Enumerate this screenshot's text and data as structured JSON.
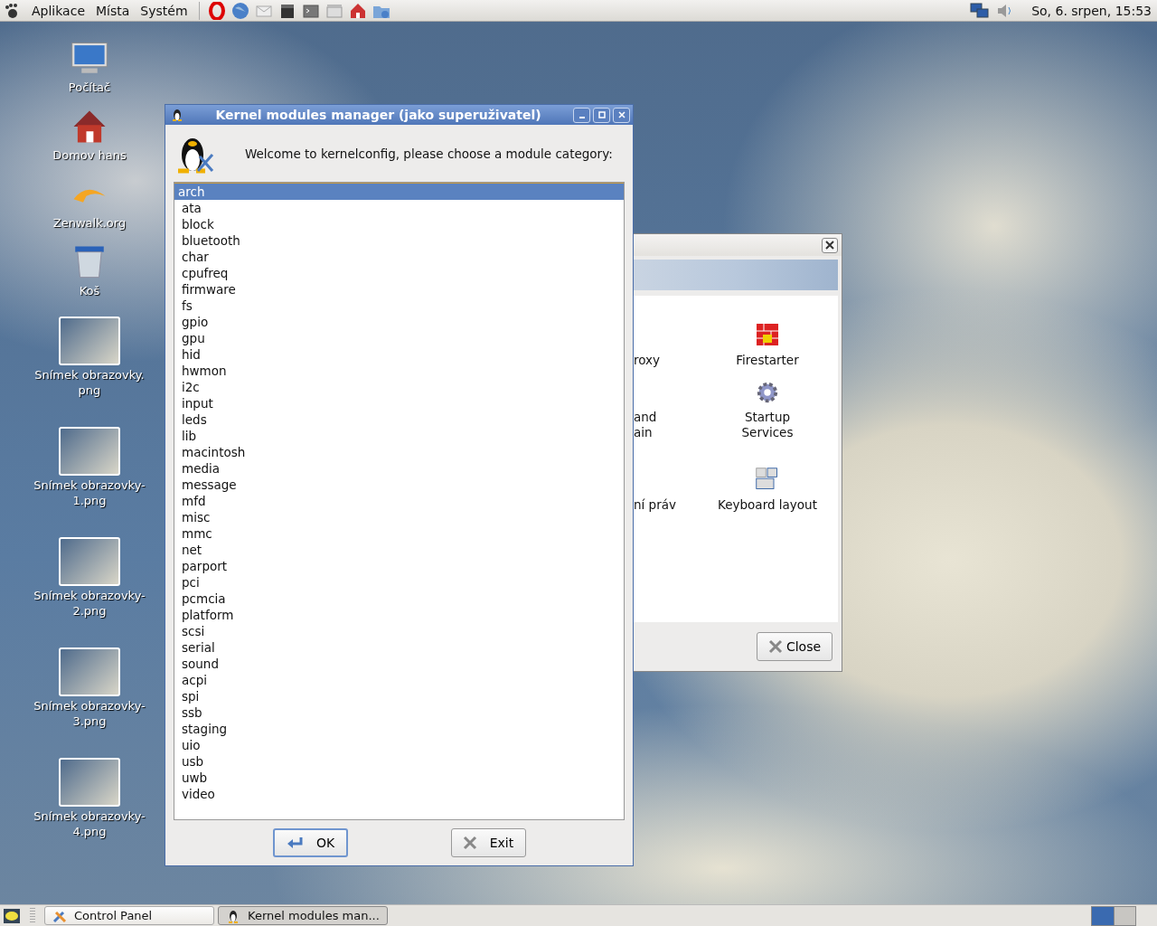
{
  "top_panel": {
    "menus": [
      "Aplikace",
      "Místa",
      "Systém"
    ],
    "clock": "So,  6. srpen, 15:53"
  },
  "desktop_icons": [
    {
      "label": "Počítač",
      "kind": "computer"
    },
    {
      "label": "Domov hans",
      "kind": "home"
    },
    {
      "label": "Zenwalk.org",
      "kind": "web"
    },
    {
      "label": "Koš",
      "kind": "trash"
    },
    {
      "label": "Snímek obrazovky.\npng",
      "kind": "screenshot"
    },
    {
      "label": "Snímek obrazovky-\n1.png",
      "kind": "screenshot"
    },
    {
      "label": "Snímek obrazovky-\n2.png",
      "kind": "screenshot"
    },
    {
      "label": "Snímek obrazovky-\n3.png",
      "kind": "screenshot"
    },
    {
      "label": "Snímek obrazovky-\n4.png",
      "kind": "screenshot"
    }
  ],
  "control_panel": {
    "items": [
      {
        "label": "roxy",
        "kind": "cut"
      },
      {
        "label": "Firestarter",
        "kind": "firewall"
      },
      {
        "label": "and\nain",
        "kind": "cut"
      },
      {
        "label": "Startup\nServices",
        "kind": "gear"
      },
      {
        "label": "ní práv",
        "kind": "cut"
      },
      {
        "label": "Keyboard layout",
        "kind": "keyboard"
      }
    ],
    "close_button": "Close"
  },
  "kernel_window": {
    "title": "Kernel modules manager (jako superuživatel)",
    "welcome": "Welcome to kernelconfig, please choose a module category:",
    "modules": [
      {
        "name": "arch",
        "selected": true
      },
      {
        "name": "ata",
        "selected": false
      },
      {
        "name": "block",
        "selected": false
      },
      {
        "name": "bluetooth",
        "selected": false
      },
      {
        "name": "char",
        "selected": false
      },
      {
        "name": "cpufreq",
        "selected": false
      },
      {
        "name": "firmware",
        "selected": false
      },
      {
        "name": "fs",
        "selected": false
      },
      {
        "name": "gpio",
        "selected": false
      },
      {
        "name": "gpu",
        "selected": false
      },
      {
        "name": "hid",
        "selected": false
      },
      {
        "name": "hwmon",
        "selected": false
      },
      {
        "name": "i2c",
        "selected": false
      },
      {
        "name": "input",
        "selected": false
      },
      {
        "name": "leds",
        "selected": false
      },
      {
        "name": "lib",
        "selected": false
      },
      {
        "name": "macintosh",
        "selected": false
      },
      {
        "name": "media",
        "selected": false
      },
      {
        "name": "message",
        "selected": false
      },
      {
        "name": "mfd",
        "selected": false
      },
      {
        "name": "misc",
        "selected": false
      },
      {
        "name": "mmc",
        "selected": false
      },
      {
        "name": "net",
        "selected": false
      },
      {
        "name": "parport",
        "selected": false
      },
      {
        "name": "pci",
        "selected": false
      },
      {
        "name": "pcmcia",
        "selected": false
      },
      {
        "name": "platform",
        "selected": false
      },
      {
        "name": "scsi",
        "selected": false
      },
      {
        "name": "serial",
        "selected": false
      },
      {
        "name": "sound",
        "selected": false
      },
      {
        "name": "acpi",
        "selected": false
      },
      {
        "name": "spi",
        "selected": false
      },
      {
        "name": "ssb",
        "selected": false
      },
      {
        "name": "staging",
        "selected": false
      },
      {
        "name": "uio",
        "selected": false
      },
      {
        "name": "usb",
        "selected": false
      },
      {
        "name": "uwb",
        "selected": false
      },
      {
        "name": "video",
        "selected": false
      }
    ],
    "buttons": [
      {
        "label": "OK",
        "kind": "ok"
      },
      {
        "label": "Exit",
        "kind": "exit"
      }
    ]
  },
  "taskbar": {
    "items": [
      {
        "label": "Control Panel",
        "kind": "tools",
        "selected": false
      },
      {
        "label": "Kernel modules man...",
        "kind": "penguin",
        "selected": true
      }
    ]
  }
}
